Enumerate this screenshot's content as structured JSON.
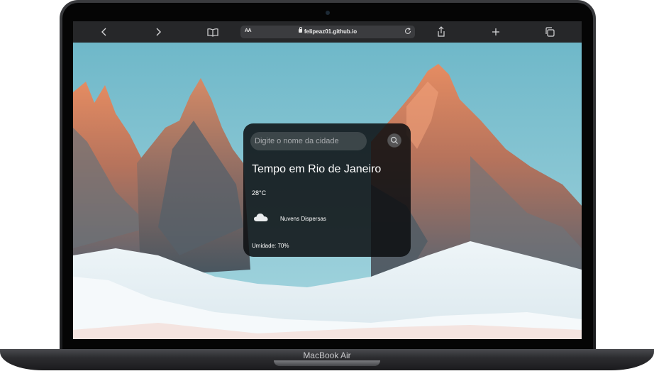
{
  "browser": {
    "url_aa": "AA",
    "url": "felipeaz01.github.io"
  },
  "weather": {
    "search_placeholder": "Digite o nome da cidade",
    "city_title": "Tempo em Rio de Janeiro",
    "temperature": "28°C",
    "description": "Nuvens Dispersas",
    "humidity": "Umidade: 70%"
  },
  "device": {
    "model": "MacBook Air"
  },
  "icons": [
    "back-icon",
    "forward-icon",
    "book-icon",
    "lock-icon",
    "reload-icon",
    "share-icon",
    "plus-icon",
    "tabs-icon",
    "search-icon",
    "cloud-icon"
  ]
}
